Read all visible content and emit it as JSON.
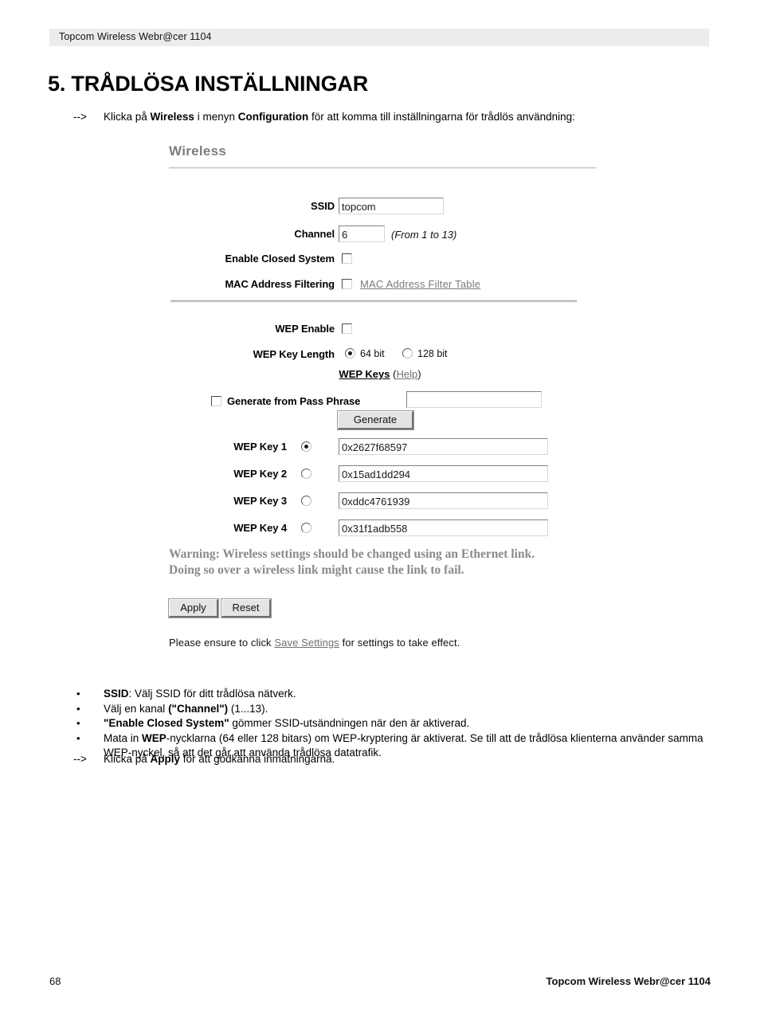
{
  "header": {
    "running_head": "Topcom Wireless Webr@cer 1104"
  },
  "chapter": {
    "title": "5. TRÅDLÖSA INSTÄLLNINGAR"
  },
  "intro": {
    "arrow": "-->",
    "text_1": "Klicka på ",
    "bold_1": "Wireless",
    "text_2": " i menyn ",
    "bold_2": "Configuration",
    "text_3": " för att komma till inställningarna för trådlös användning:"
  },
  "router_ui": {
    "panel_title": "Wireless",
    "fields": {
      "ssid_label": "SSID",
      "ssid_value": "topcom",
      "channel_label": "Channel",
      "channel_value": "6",
      "channel_hint": "(From 1 to 13)",
      "closed_system_label": "Enable Closed System",
      "mac_filtering_label": "MAC Address Filtering",
      "mac_filter_table_link": "MAC Address Filter Table"
    },
    "wep": {
      "enable_label": "WEP Enable",
      "key_length_label": "WEP Key Length",
      "option_64": "64 bit",
      "option_128": "128 bit",
      "keys_heading": "WEP Keys",
      "help_open": "(",
      "help_label": "Help",
      "help_close": ")",
      "generate_from_pass_phrase_label": "Generate from Pass Phrase",
      "pass_phrase_value": "",
      "generate_button": "Generate",
      "keys": [
        {
          "label": "WEP Key 1",
          "value": "0x2627f68597",
          "selected": true
        },
        {
          "label": "WEP Key 2",
          "value": "0x15ad1dd294",
          "selected": false
        },
        {
          "label": "WEP Key 3",
          "value": "0xddc4761939",
          "selected": false
        },
        {
          "label": "WEP Key 4",
          "value": "0x31f1adb558",
          "selected": false
        }
      ]
    },
    "warning_line_1": "Warning: Wireless settings should be changed using an Ethernet link.",
    "warning_line_2": "Doing so over a wireless link might cause the link to fail.",
    "buttons": {
      "apply": "Apply",
      "reset": "Reset"
    },
    "ensure": {
      "before": "Please ensure to click ",
      "link": "Save Settings",
      "after": " for settings to take effect."
    }
  },
  "bullets": [
    {
      "bullet": "•",
      "bold_lead": "SSID",
      "text": ": Välj SSID för ditt trådlösa nätverk."
    },
    {
      "bullet": "•",
      "pre": "Välj en kanal ",
      "bold_mid": "(\"Channel\")",
      "text": " (1...13)."
    },
    {
      "bullet": "•",
      "bold_lead": "\"Enable Closed System\"",
      "text": " gömmer SSID-utsändningen när den är aktiverad."
    },
    {
      "bullet": "•",
      "pre": "Mata in ",
      "bold_mid": "WEP",
      "text": "-nycklarna (64 eller 128 bitars) om WEP-kryptering är aktiverat. Se till att de trådlösa klienterna använder samma WEP-nyckel, så att det går att använda trådlösa datatrafik."
    }
  ],
  "apply_para": {
    "arrow": "-->",
    "text_1": "Klicka på ",
    "bold_1": "Apply",
    "text_2": " för att godkänna inmatningarna."
  },
  "footer": {
    "page_number": "68",
    "brand": "Topcom Wireless Webr@cer 1104"
  }
}
